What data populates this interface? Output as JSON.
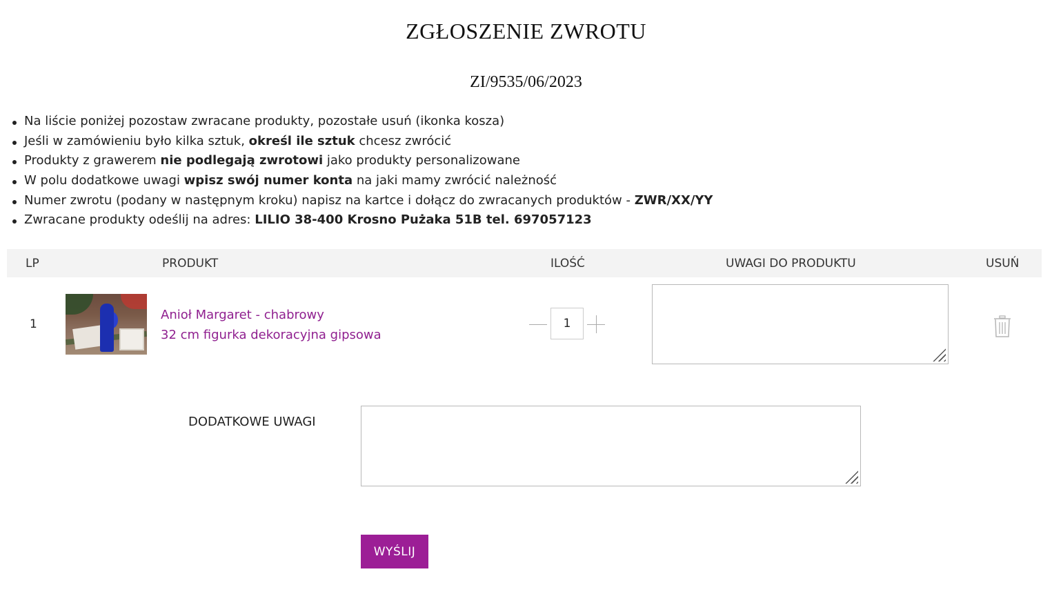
{
  "page": {
    "title": "ZGŁOSZENIE ZWROTU",
    "return_number": "ZI/9535/06/2023"
  },
  "instructions": [
    {
      "parts": [
        {
          "text": "Na liście poniżej pozostaw zwracane produkty, pozostałe usuń (ikonka kosza)",
          "bold": false
        }
      ]
    },
    {
      "parts": [
        {
          "text": "Jeśli w zamówieniu było kilka sztuk, ",
          "bold": false
        },
        {
          "text": "określ ile sztuk",
          "bold": true
        },
        {
          "text": " chcesz zwrócić",
          "bold": false
        }
      ]
    },
    {
      "parts": [
        {
          "text": "Produkty z grawerem ",
          "bold": false
        },
        {
          "text": "nie podlegają zwrotowi",
          "bold": true
        },
        {
          "text": " jako produkty personalizowane",
          "bold": false
        }
      ]
    },
    {
      "parts": [
        {
          "text": "W polu dodatkowe uwagi ",
          "bold": false
        },
        {
          "text": "wpisz swój numer konta",
          "bold": true
        },
        {
          "text": " na jaki mamy zwrócić należność",
          "bold": false
        }
      ]
    },
    {
      "parts": [
        {
          "text": "Numer zwrotu (podany w następnym kroku) napisz na kartce i dołącz do zwracanych produktów - ",
          "bold": false
        },
        {
          "text": "ZWR/XX/YY",
          "bold": true
        }
      ]
    },
    {
      "parts": [
        {
          "text": "Zwracane produkty odeślij na adres: ",
          "bold": false
        },
        {
          "text": "LILIO 38-400 Krosno Pużaka 51B tel. 697057123",
          "bold": true
        }
      ]
    }
  ],
  "table": {
    "headers": {
      "lp": "LP",
      "product": "PRODUKT",
      "qty": "ILOŚĆ",
      "notes": "UWAGI DO PRODUKTU",
      "remove": "USUŃ"
    },
    "rows": [
      {
        "lp": "1",
        "name_line1": "Anioł Margaret - chabrowy",
        "name_line2": "32 cm figurka dekoracyjna gipsowa",
        "quantity": "1",
        "notes": ""
      }
    ]
  },
  "extra_notes": {
    "label": "DODATKOWE UWAGI",
    "value": ""
  },
  "submit": {
    "label": "WYŚLIJ"
  },
  "colors": {
    "accent": "#9c1e96",
    "link": "#8f1f8f",
    "header_bg": "#f3f3f3"
  },
  "icons": {
    "qty_decrease": "minus-icon",
    "qty_increase": "plus-icon",
    "remove": "trash-icon",
    "resize": "resize-grip-icon"
  }
}
